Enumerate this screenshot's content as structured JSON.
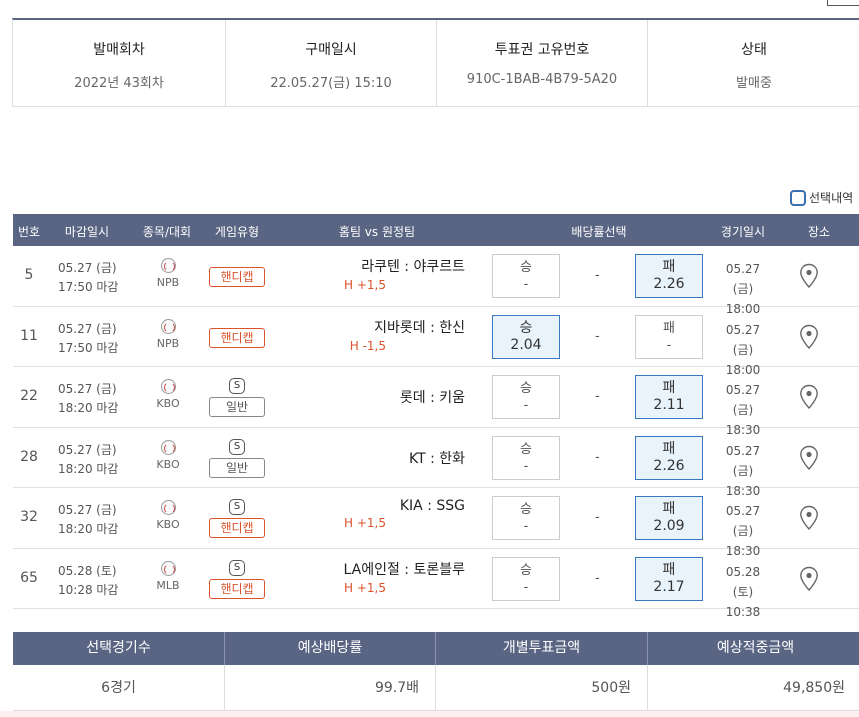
{
  "ticket": {
    "headers": [
      "발매회차",
      "구매일시",
      "투표권 고유번호",
      "상태"
    ],
    "values": [
      "2022년 43회차",
      "22.05.27(금) 15:10",
      "910C-1BAB-4B79-5A20",
      "발매중"
    ]
  },
  "selection_toggle": {
    "label": "선택내역",
    "checked": false
  },
  "game_table": {
    "columns": [
      "번호",
      "마감일시",
      "종목/대회",
      "게임유형",
      "홈팀 vs 원정팀",
      "배당률선택",
      "경기일시",
      "장소"
    ],
    "rows": [
      {
        "no": "5",
        "deadline_date": "05.27 (금)",
        "deadline_time": "17:50 마감",
        "league": "NPB",
        "special": false,
        "type": "핸디캡",
        "match": "라쿠텐 : 야쿠르트",
        "handicap": "H +1,5",
        "win_label": "승",
        "win_odds": "-",
        "draw": "-",
        "lose_label": "패",
        "lose_odds": "2.26",
        "selected": "lose",
        "game_date": "05.27 (금)",
        "game_time": "18:00"
      },
      {
        "no": "11",
        "deadline_date": "05.27 (금)",
        "deadline_time": "17:50 마감",
        "league": "NPB",
        "special": false,
        "type": "핸디캡",
        "match": "지바롯데 : 한신",
        "handicap": "H -1,5",
        "win_label": "승",
        "win_odds": "2.04",
        "draw": "-",
        "lose_label": "패",
        "lose_odds": "-",
        "selected": "win",
        "game_date": "05.27 (금)",
        "game_time": "18:00"
      },
      {
        "no": "22",
        "deadline_date": "05.27 (금)",
        "deadline_time": "18:20 마감",
        "league": "KBO",
        "special": true,
        "type": "일반",
        "match": "롯데 : 키움",
        "handicap": "",
        "win_label": "승",
        "win_odds": "-",
        "draw": "-",
        "lose_label": "패",
        "lose_odds": "2.11",
        "selected": "lose",
        "game_date": "05.27 (금)",
        "game_time": "18:30"
      },
      {
        "no": "28",
        "deadline_date": "05.27 (금)",
        "deadline_time": "18:20 마감",
        "league": "KBO",
        "special": true,
        "type": "일반",
        "match": "KT : 한화",
        "handicap": "",
        "win_label": "승",
        "win_odds": "-",
        "draw": "-",
        "lose_label": "패",
        "lose_odds": "2.26",
        "selected": "lose",
        "game_date": "05.27 (금)",
        "game_time": "18:30"
      },
      {
        "no": "32",
        "deadline_date": "05.27 (금)",
        "deadline_time": "18:20 마감",
        "league": "KBO",
        "special": true,
        "type": "핸디캡",
        "match": "KIA : SSG",
        "handicap": "H +1,5",
        "win_label": "승",
        "win_odds": "-",
        "draw": "-",
        "lose_label": "패",
        "lose_odds": "2.09",
        "selected": "lose",
        "game_date": "05.27 (금)",
        "game_time": "18:30"
      },
      {
        "no": "65",
        "deadline_date": "05.28 (토)",
        "deadline_time": "10:28 마감",
        "league": "MLB",
        "special": true,
        "type": "핸디캡",
        "match": "LA에인절 : 토론블루",
        "handicap": "H +1,5",
        "win_label": "승",
        "win_odds": "-",
        "draw": "-",
        "lose_label": "패",
        "lose_odds": "2.17",
        "selected": "lose",
        "game_date": "05.28 (토)",
        "game_time": "10:38"
      }
    ],
    "special_icon_text": "S",
    "icons": {
      "sport": "baseball-icon",
      "place": "map-pin-icon",
      "special": "special-s-icon"
    }
  },
  "summary": {
    "headers": [
      "선택경기수",
      "예상배당률",
      "개별투표금액",
      "예상적중금액"
    ],
    "values": [
      "6경기",
      "99.7배",
      "500원",
      "49,850원"
    ]
  },
  "colors": {
    "header_bg": "#5a6583",
    "handicap": "#d9532b",
    "selected_border": "#3a78c0",
    "selected_bg": "#e8f3fb"
  }
}
